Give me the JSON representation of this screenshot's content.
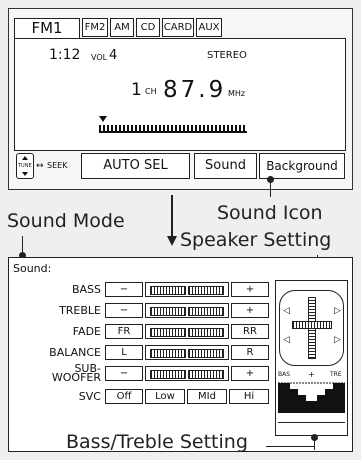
{
  "tabs": [
    "FM1",
    "FM2",
    "AM",
    "CD",
    "CARD",
    "AUX"
  ],
  "lcd": {
    "time": "1:12",
    "vol_label": "VOL",
    "vol": "4",
    "stereo": "STEREO",
    "ch": "1",
    "ch_label": "CH",
    "freq": "87.9",
    "mhz": "MHz"
  },
  "controls": {
    "tune": "TUNE",
    "seek": "SEEK",
    "auto_sel": "AUTO SEL",
    "sound": "Sound",
    "background": "Background"
  },
  "callouts": {
    "sound_mode": "Sound Mode",
    "sound_icon": "Sound Icon",
    "speaker": "Speaker Setting",
    "bass_treble": "Bass/Treble Setting"
  },
  "sound": {
    "title": "Sound:",
    "rows": [
      {
        "label": "BASS",
        "left": "−",
        "right": "+"
      },
      {
        "label": "TREBLE",
        "left": "−",
        "right": "+"
      },
      {
        "label": "FADE",
        "left": "FR",
        "right": "RR"
      },
      {
        "label": "BALANCE",
        "left": "L",
        "right": "R"
      },
      {
        "label": "SUB-",
        "label2": "WOOFER",
        "left": "−",
        "right": "+"
      }
    ],
    "svc_label": "SVC",
    "svc": [
      "Off",
      "Low",
      "MId",
      "Hi"
    ],
    "eq_bas": "BAS",
    "eq_plus": "+",
    "eq_tre": "TRE"
  }
}
